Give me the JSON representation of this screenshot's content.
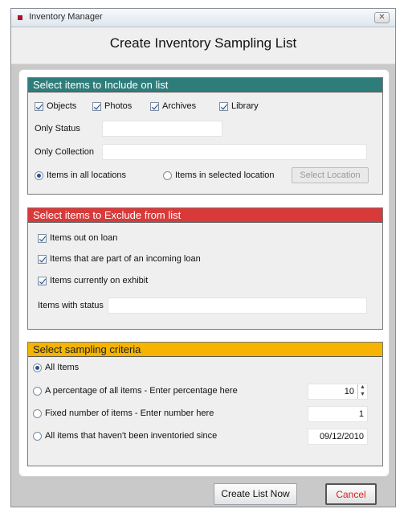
{
  "window": {
    "title": "Inventory Manager",
    "close_glyph": "✕"
  },
  "header": {
    "title": "Create Inventory Sampling List"
  },
  "include": {
    "title": "Select items to Include on list",
    "checkboxes": [
      {
        "label": "Objects",
        "checked": true
      },
      {
        "label": "Photos",
        "checked": true
      },
      {
        "label": "Archives",
        "checked": true
      },
      {
        "label": "Library",
        "checked": true
      }
    ],
    "only_status_label": "Only Status",
    "only_status_value": "",
    "only_collection_label": "Only Collection",
    "only_collection_value": "",
    "location_all_label": "Items in all locations",
    "location_selected_label": "Items in selected location",
    "select_location_button": "Select Location"
  },
  "exclude": {
    "title": "Select items to Exclude from list",
    "checkboxes": [
      {
        "label": "Items out on loan",
        "checked": true
      },
      {
        "label": "Items that are part of an incoming loan",
        "checked": true
      },
      {
        "label": "Items currently on exhibit",
        "checked": true
      }
    ],
    "status_label": "Items with status",
    "status_value": ""
  },
  "criteria": {
    "title": "Select sampling criteria",
    "options": [
      {
        "label": "All Items",
        "selected": true
      },
      {
        "label": "A percentage of all items - Enter percentage here",
        "value": "10"
      },
      {
        "label": "Fixed number of items - Enter number here",
        "value": "1"
      },
      {
        "label": "All items that haven't been inventoried since",
        "value": "09/12/2010"
      }
    ]
  },
  "footer": {
    "create_button": "Create List Now",
    "cancel_button": "Cancel"
  },
  "colors": {
    "include_header": "#2f7d7b",
    "exclude_header": "#d83a3a",
    "criteria_header": "#f4b400"
  }
}
